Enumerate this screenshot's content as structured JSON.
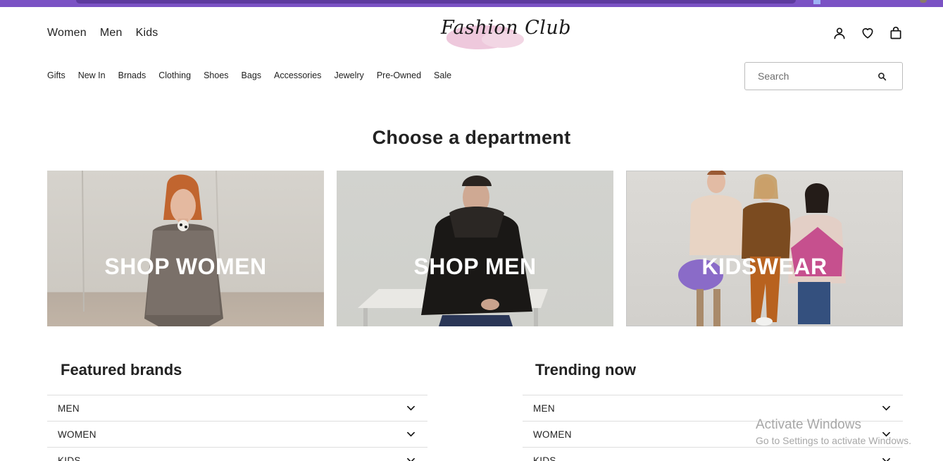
{
  "header": {
    "departments": [
      "Women",
      "Men",
      "Kids"
    ],
    "logo_text": "Fashion Club",
    "categories": [
      "Gifts",
      "New In",
      "Brnads",
      "Clothing",
      "Shoes",
      "Bags",
      "Accessories",
      "Jewelry",
      "Pre-Owned",
      "Sale"
    ],
    "search": {
      "placeholder": "Search"
    },
    "icons": [
      "user-icon",
      "heart-icon",
      "shopping-bag-icon",
      "search-icon"
    ]
  },
  "main": {
    "heading": "Choose a department",
    "tiles": [
      {
        "label": "SHOP WOMEN"
      },
      {
        "label": "SHOP MEN"
      },
      {
        "label": "KIDSWEAR"
      }
    ]
  },
  "featured": {
    "title": "Featured brands",
    "items": [
      "MEN",
      "WOMEN",
      "KIDS"
    ]
  },
  "trending": {
    "title": "Trending now",
    "items": [
      "MEN",
      "WOMEN",
      "KIDS"
    ]
  },
  "watermark": {
    "line1": "Activate Windows",
    "line2": "Go to Settings to activate Windows."
  }
}
